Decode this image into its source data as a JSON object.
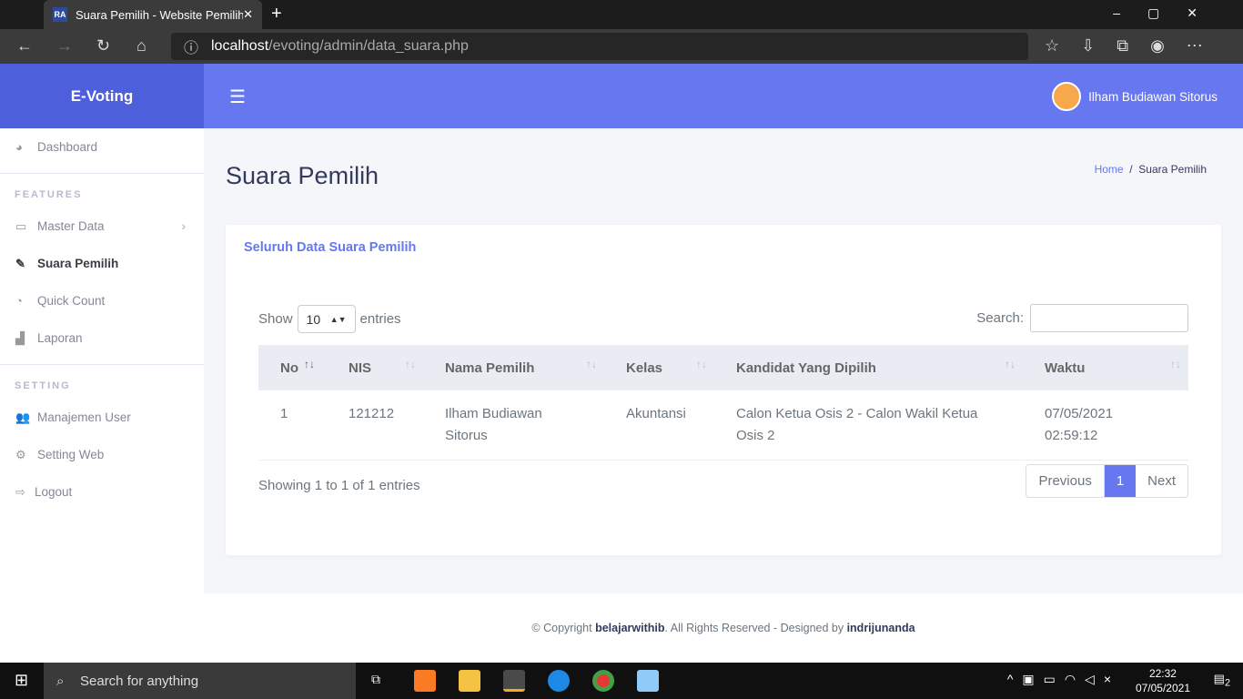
{
  "browser": {
    "tab_title": "Suara Pemilih - Website Pemilihan",
    "favicon": "RA",
    "url_host": "localhost",
    "url_path": "/evoting/admin/data_suara.php"
  },
  "sidebar": {
    "brand": "E-Voting",
    "items": [
      {
        "label": "Dashboard",
        "icon": "tachometer-icon"
      }
    ],
    "features_header": "FEATURES",
    "features": [
      {
        "label": "Master Data",
        "icon": "window-icon"
      },
      {
        "label": "Suara Pemilih",
        "icon": "pencil-icon",
        "active": true
      },
      {
        "label": "Quick Count",
        "icon": "pie-chart-icon"
      },
      {
        "label": "Laporan",
        "icon": "area-chart-icon"
      }
    ],
    "setting_header": "SETTING",
    "settings": [
      {
        "label": "Manajemen User",
        "icon": "users-icon"
      },
      {
        "label": "Setting Web",
        "icon": "cogs-icon"
      },
      {
        "label": "Logout",
        "icon": "sign-out-icon"
      }
    ]
  },
  "topbar": {
    "user_name": "Ilham Budiawan Sitorus"
  },
  "page": {
    "title": "Suara Pemilih",
    "breadcrumb": [
      "Home",
      "/",
      "Suara Pemilih"
    ]
  },
  "card": {
    "title": "Seluruh Data Suara Pemilih",
    "show_label": "Show",
    "entries_value": "10",
    "entries_label": "entries",
    "search_label": "Search:",
    "columns": [
      "No",
      "NIS",
      "Nama Pemilih",
      "Kelas",
      "Kandidat Yang Dipilih",
      "Waktu"
    ],
    "rows": [
      [
        "1",
        "121212",
        "Ilham Budiawan Sitorus",
        "Akuntansi",
        "Calon Ketua Osis 2 - Calon Wakil Ketua Osis 2",
        "07/05/2021 02:59:12"
      ]
    ],
    "info": "Showing 1 to 1 of 1 entries",
    "pagination": {
      "previous": "Previous",
      "current": "1",
      "next": "Next"
    }
  },
  "footer": {
    "prefix": "© Copyright ",
    "site": "belajarwithib",
    "middle": ". All Rights Reserved - Designed by ",
    "designer": "indrijunanda"
  },
  "taskbar": {
    "search_placeholder": "Search for anything",
    "time": "22:32",
    "date": "07/05/2021",
    "notifications": "2"
  },
  "colors": {
    "accent": "#6777ef",
    "brand": "#4e5fdb"
  }
}
